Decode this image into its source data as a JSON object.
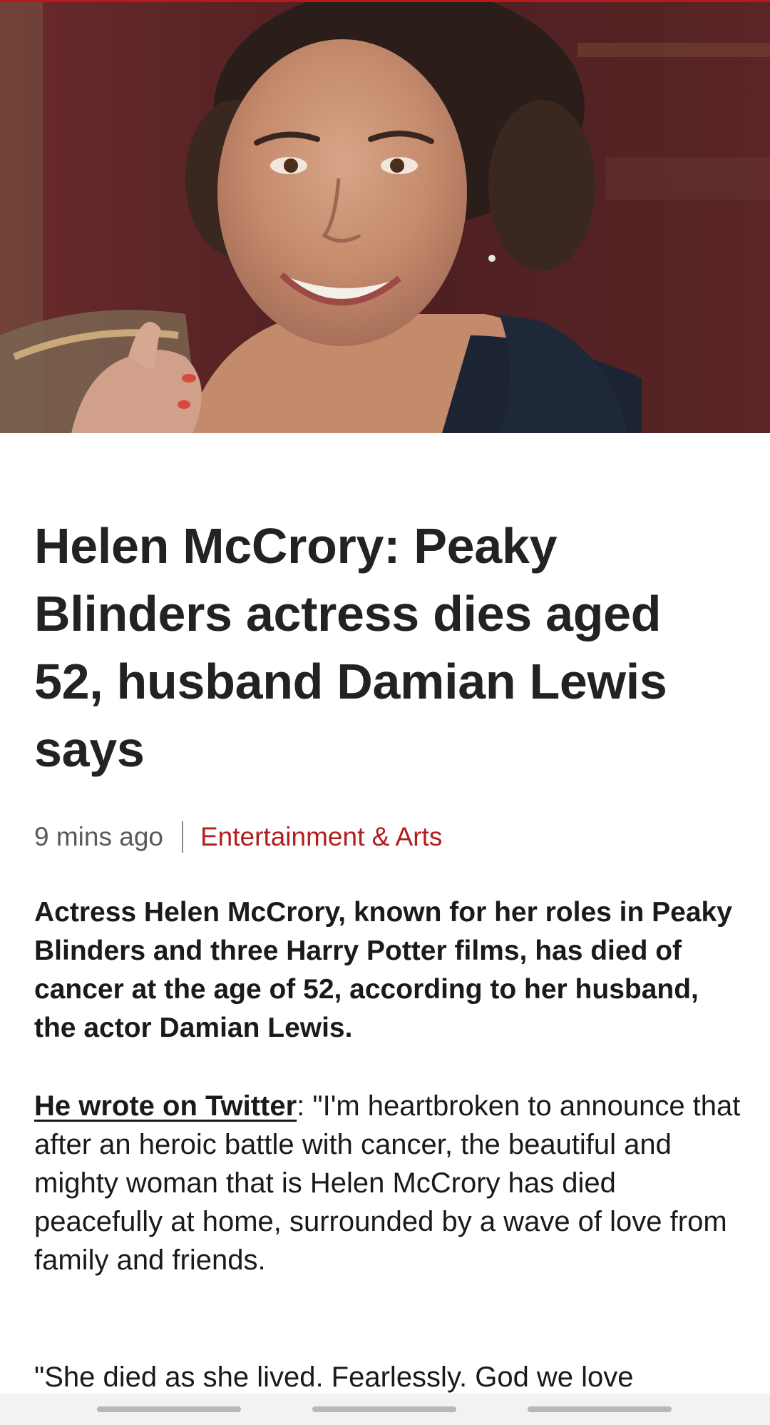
{
  "theme": {
    "accent": "#bb1919",
    "topic_color": "#b31d1d"
  },
  "hero": {
    "alt": "Photo of Helen McCrory smiling"
  },
  "article": {
    "headline": "Helen McCrory: Peaky Blinders actress dies aged 52, husband Damian Lewis says",
    "timestamp": "9 mins ago",
    "topic": "Entertainment & Arts",
    "intro": "Actress Helen McCrory, known for her roles in Peaky Blinders and three Harry Potter films, has died of cancer at the age of 52, according to her husband, the actor Damian Lewis.",
    "para1_link": "He wrote on Twitter",
    "para1_text": ": \"I'm heartbroken to announce that after an heroic battle with cancer, the beautiful and mighty woman that is Helen McCrory has died peacefully at home, surrounded by a wave of love from family and friends.",
    "para2_text": "\"She died as she lived. Fearlessly. God we love"
  },
  "icons": {
    "hero_image": "photo-image",
    "nav_handle": "gesture-nav-handle"
  }
}
